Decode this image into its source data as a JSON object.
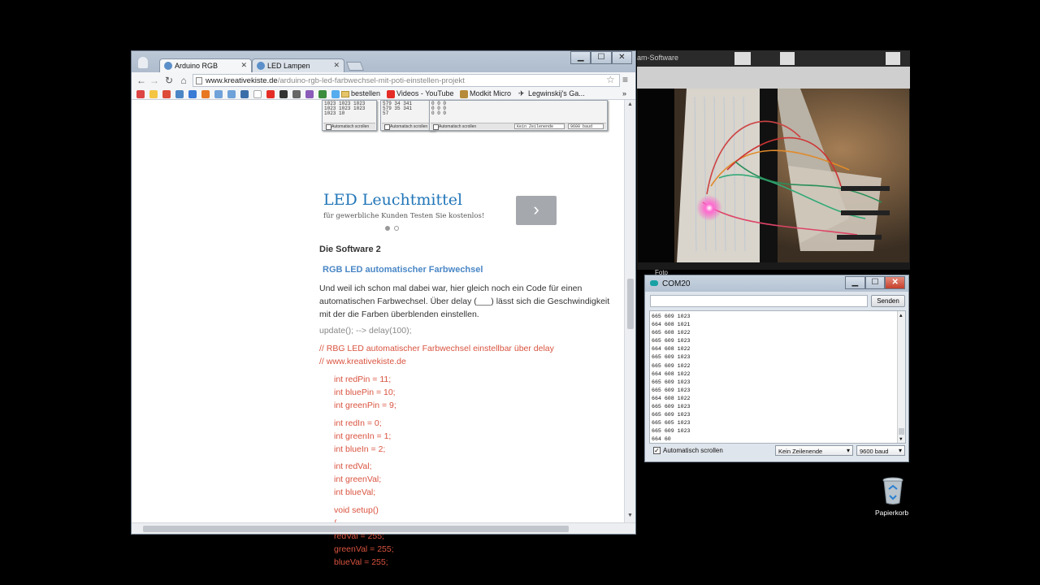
{
  "browser": {
    "tabs": [
      {
        "label": "Arduino RGB",
        "active": true
      },
      {
        "label": "LED Lampen",
        "active": false
      }
    ],
    "window_buttons": {
      "minimize": "▁",
      "maximize": "☐",
      "close": "✕"
    },
    "url_host": "www.kreativekiste.de",
    "url_path": "/arduino-rgb-led-farbwechsel-mit-poti-einstellen-projekt",
    "bookmarks": [
      {
        "label": "bestellen",
        "icon": "folder-icon"
      },
      {
        "label": "Videos - YouTube",
        "icon": "youtube-icon"
      },
      {
        "label": "Modkit Micro",
        "icon": "modkit-icon"
      },
      {
        "label": "Legwinskij's Ga...",
        "icon": "legwinskij-icon"
      }
    ]
  },
  "page": {
    "thumb1_lines": [
      "1023 1023 1023",
      "1023 1023 1023",
      "1023 10"
    ],
    "thumb2_lines": [
      "579 34 341",
      "579 35 341",
      "57"
    ],
    "thumb3_lines": [
      "0 0 0",
      "0 0 0",
      "0 0 0"
    ],
    "thumb_autoscroll": "Automatisch scrollen",
    "thumb_lineend": "Kein Zeilenende",
    "thumb_baud": "9600 baud",
    "ad_title": "LED Leuchtmittel",
    "ad_subtitle": "für gewerbliche Kunden Testen Sie kostenlos!",
    "ad_next": "›",
    "heading": "Die Software 2",
    "subheading": "RGB LED automatischer Farbwechsel",
    "paragraph": " Und weil ich schon mal dabei war, hier gleich noch ein Code für einen automatischen Farbwechsel. Über delay (___) lässt sich die Geschwindigkeit mit der die Farben überblenden einstellen.",
    "code_grey": "update(); --> delay(100);",
    "code_comment1": "// RBG LED automatischer Farbwechsel einstellbar über delay",
    "code_comment2": "// www.kreativekiste.de",
    "code_lines": [
      "int redPin = 11;",
      "int bluePin = 10;",
      "int greenPin = 9;",
      "int redIn = 0;",
      "int greenIn = 1;",
      "int blueIn = 2;",
      "int redVal;",
      "int greenVal;",
      "int blueVal;",
      "void setup()",
      "{",
      "redVal = 255;",
      "greenVal = 255;",
      "blueVal = 255;"
    ]
  },
  "camera": {
    "title_fragment": "am-Software",
    "foto_label": "Foto"
  },
  "serial": {
    "title": "COM20",
    "send_label": "Senden",
    "input_value": "",
    "lines": [
      "665 609 1023",
      "664 608 1021",
      "665 608 1022",
      "665 609 1023",
      "664 608 1022",
      "665 609 1023",
      "665 609 1022",
      "664 608 1022",
      "665 609 1023",
      "665 609 1023",
      "664 608 1022",
      "665 609 1023",
      "665 609 1023",
      "665 605 1023",
      "665 609 1023",
      "664 60"
    ],
    "autoscroll_label": "Automatisch scrollen",
    "autoscroll_checked": true,
    "line_ending": "Kein Zeilenende",
    "baud": "9600 baud"
  },
  "desktop": {
    "recycle_bin_label": "Papierkorb"
  }
}
